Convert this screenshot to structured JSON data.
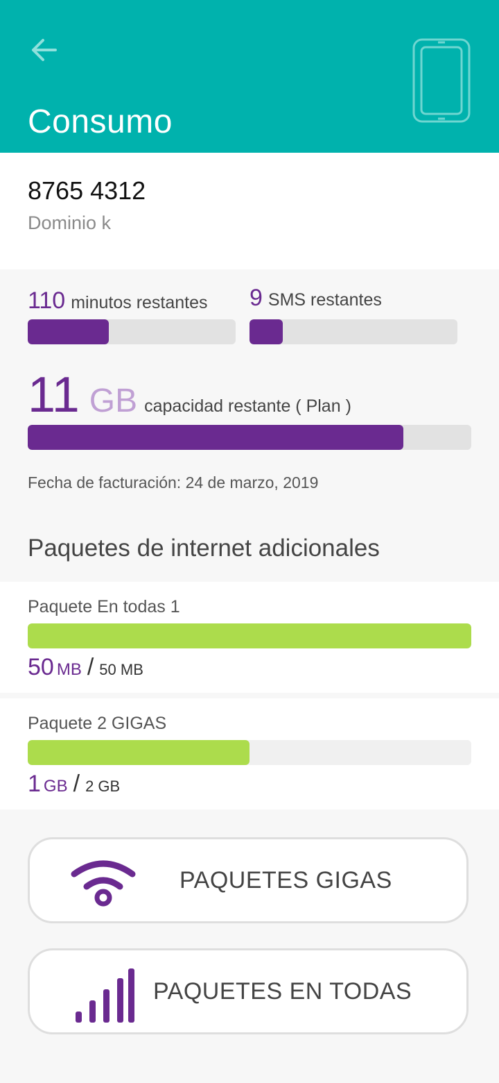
{
  "header": {
    "title": "Consumo",
    "back_icon": "arrow-left-icon",
    "device_icon": "phone-icon",
    "bg_color": "#00b2ad"
  },
  "account": {
    "number": "8765 4312",
    "name": "Dominio k"
  },
  "usage": {
    "minutes": {
      "value": "110",
      "label": "minutos restantes",
      "fraction": 0.39
    },
    "sms": {
      "value": "9",
      "label": "SMS restantes",
      "fraction": 0.16
    },
    "data": {
      "value": "11",
      "unit": "GB",
      "label": "capacidad restante ( Plan )",
      "fraction": 0.847
    },
    "billing_date": "Fecha de facturación: 24 de marzo, 2019",
    "accent_color": "#6a2a90"
  },
  "packages": {
    "section_title": "Paquetes de internet adicionales",
    "items": [
      {
        "name": "Paquete En todas 1",
        "used": "50",
        "used_unit": "MB",
        "slash": "/",
        "total": "50 MB",
        "fraction": 1.0
      },
      {
        "name": "Paquete 2 GIGAS",
        "used": "1",
        "used_unit": "GB",
        "slash": "/",
        "total": "2 GB",
        "fraction": 0.5
      }
    ],
    "bar_color": "#acdc4c"
  },
  "buttons": {
    "gigas": {
      "label": "PAQUETES GIGAS",
      "icon": "wifi-icon"
    },
    "en_todas": {
      "label": "PAQUETES EN TODAS",
      "icon": "signal-bars-icon"
    }
  }
}
